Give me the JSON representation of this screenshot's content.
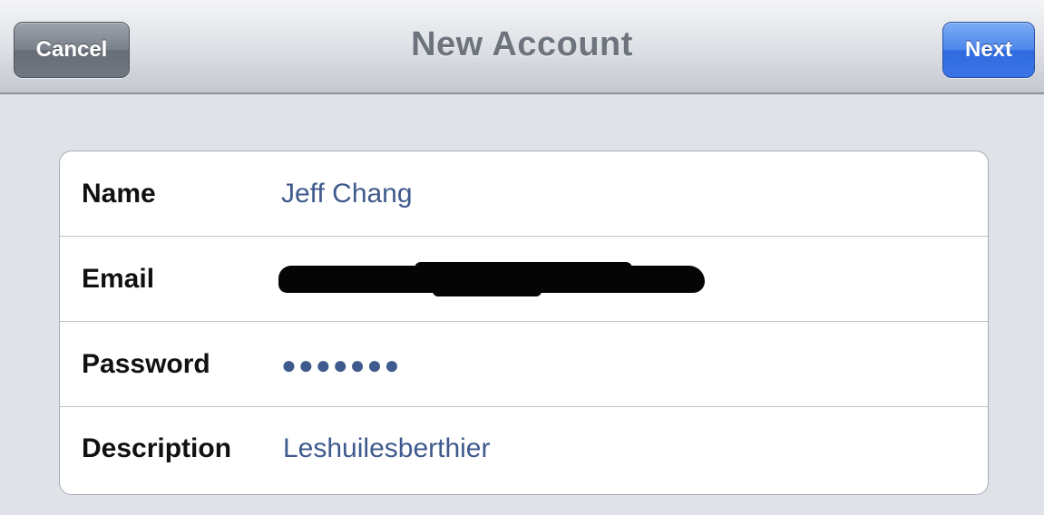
{
  "navbar": {
    "cancel_label": "Cancel",
    "title": "New Account",
    "next_label": "Next"
  },
  "form": {
    "rows": [
      {
        "label": "Name",
        "value": "Jeff Chang"
      },
      {
        "label": "Email",
        "value": ""
      },
      {
        "label": "Password",
        "value": "●●●●●●●"
      },
      {
        "label": "Description",
        "value": "Leshuilesberthier"
      }
    ]
  },
  "colors": {
    "nav_title": "#6e747d",
    "cancel_button": "#707780",
    "next_button": "#3a74e6",
    "field_value": "#3f5a8c",
    "background": "#dfe2e7"
  }
}
